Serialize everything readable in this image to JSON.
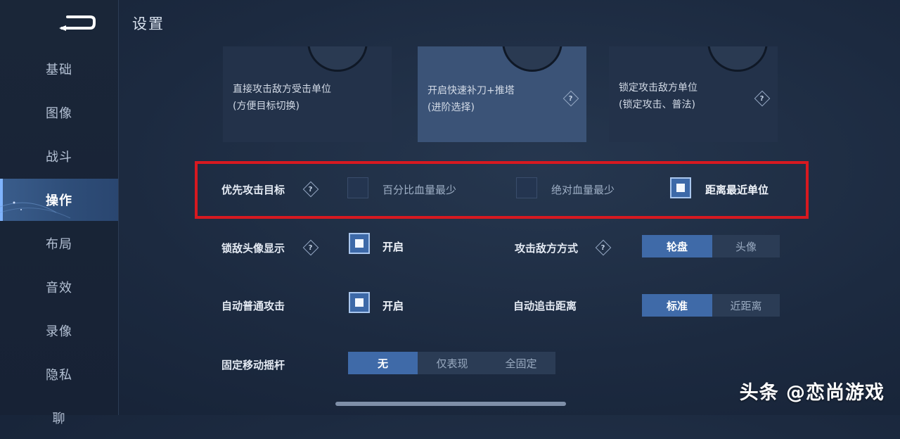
{
  "page_title": "设置",
  "sidebar": {
    "items": [
      {
        "label": "基础"
      },
      {
        "label": "图像"
      },
      {
        "label": "战斗"
      },
      {
        "label": "操作",
        "active": true
      },
      {
        "label": "布局"
      },
      {
        "label": "音效"
      },
      {
        "label": "录像"
      },
      {
        "label": "隐私"
      },
      {
        "label": "聊"
      }
    ]
  },
  "cards": [
    {
      "line1": "直接攻击敌方受击单位",
      "line2": "(方便目标切换)",
      "selected": false,
      "icon": "joystick-icon"
    },
    {
      "line1": "开启快速补刀+推塔",
      "line2": "(进阶选择)",
      "selected": true,
      "icon": "joystick-icon"
    },
    {
      "line1": "锁定攻击敌方单位",
      "line2": "(锁定攻击、普法)",
      "selected": false,
      "icon": "joystick-icon"
    }
  ],
  "priority": {
    "label": "优先攻击目标",
    "options": [
      {
        "label": "百分比血量最少",
        "checked": false
      },
      {
        "label": "绝对血量最少",
        "checked": false
      },
      {
        "label": "距离最近单位",
        "checked": true
      }
    ]
  },
  "lock_avatar": {
    "label": "锁敌头像显示",
    "option": "开启",
    "checked": true
  },
  "attack_mode": {
    "label": "攻击敌方方式",
    "options": [
      "轮盘",
      "头像"
    ],
    "selected": "轮盘"
  },
  "auto_attack": {
    "label": "自动普通攻击",
    "option": "开启",
    "checked": true
  },
  "auto_chase": {
    "label": "自动追击距离",
    "options": [
      "标准",
      "近距离"
    ],
    "selected": "标准"
  },
  "joystick": {
    "label": "固定移动摇杆",
    "options": [
      "无",
      "仅表现",
      "全固定"
    ],
    "selected": "无"
  },
  "watermark": "头条 @恋尚游戏",
  "colors": {
    "accent": "#3f6aa8",
    "highlight": "#d71920",
    "background": "#1c2a40"
  }
}
